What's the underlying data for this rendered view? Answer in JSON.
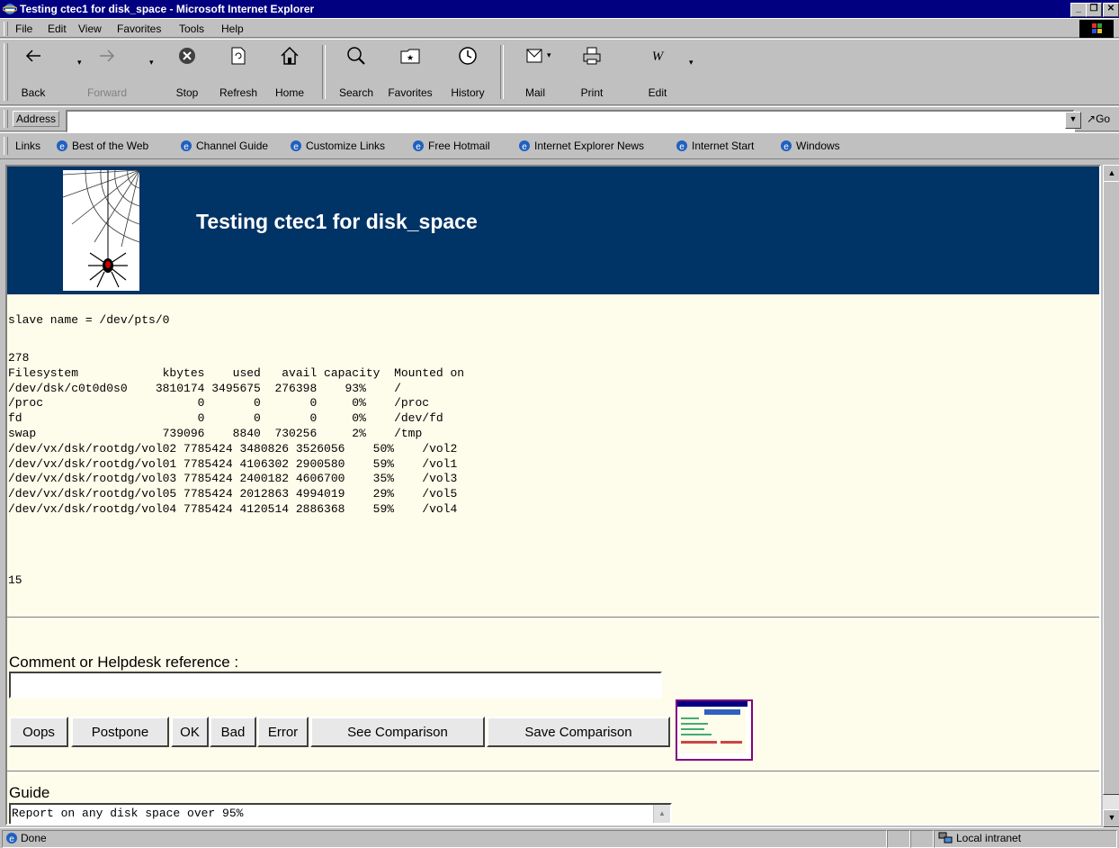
{
  "window": {
    "title": "Testing ctec1 for disk_space - Microsoft Internet Explorer"
  },
  "menu": [
    "File",
    "Edit",
    "View",
    "Favorites",
    "Tools",
    "Help"
  ],
  "toolbar": {
    "back": "Back",
    "forward": "Forward",
    "stop": "Stop",
    "refresh": "Refresh",
    "home": "Home",
    "search": "Search",
    "favorites": "Favorites",
    "history": "History",
    "mail": "Mail",
    "print": "Print",
    "edit": "Edit"
  },
  "address": {
    "label": "Address",
    "value": "",
    "go": "Go"
  },
  "links": {
    "label": "Links",
    "items": [
      "Best of the Web",
      "Channel Guide",
      "Customize Links",
      "Free Hotmail",
      "Internet Explorer News",
      "Internet Start",
      "Windows"
    ]
  },
  "page": {
    "title": "Testing ctec1 for disk_space",
    "slave_line": "slave name = /dev/pts/0",
    "df_output": "278\nFilesystem            kbytes    used   avail capacity  Mounted on\n/dev/dsk/c0t0d0s0    3810174 3495675  276398    93%    /\n/proc                      0       0       0     0%    /proc\nfd                         0       0       0     0%    /dev/fd\nswap                  739096    8840  730256     2%    /tmp\n/dev/vx/dsk/rootdg/vol02 7785424 3480826 3526056    50%    /vol2\n/dev/vx/dsk/rootdg/vol01 7785424 4106302 2900580    59%    /vol1\n/dev/vx/dsk/rootdg/vol03 7785424 2400182 4606700    35%    /vol3\n/dev/vx/dsk/rootdg/vol05 7785424 2012863 4994019    29%    /vol5\n/dev/vx/dsk/rootdg/vol04 7785424 4120514 2886368    59%    /vol4",
    "count": "15",
    "comment_label": "Comment or Helpdesk reference :",
    "comment_value": "",
    "buttons": {
      "oops": "Oops",
      "postpone": "Postpone",
      "ok": "OK",
      "bad": "Bad",
      "error": "Error",
      "see": "See Comparison",
      "save": "Save Comparison"
    },
    "guide_label": "Guide",
    "guide_text": "Report on any disk space over 95%"
  },
  "status": {
    "left": "Done",
    "zone": "Local intranet"
  },
  "colors": {
    "titlebar": "#000080",
    "banner": "#003366",
    "page_bg": "#fefcea",
    "chrome": "#c0c0c0"
  }
}
